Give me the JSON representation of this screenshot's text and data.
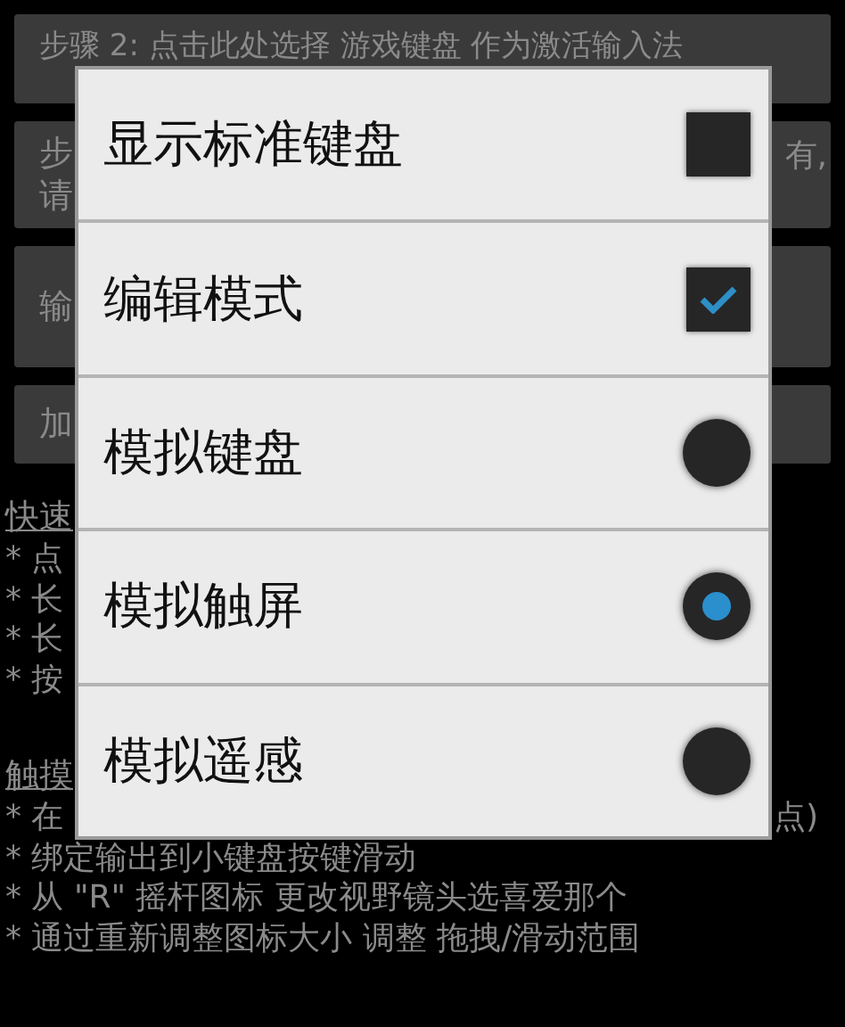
{
  "steps": [
    {
      "lines": [
        "步骤 2: 点击此处选择 游戏键盘 作为激活输入法"
      ]
    },
    {
      "lines": [
        "步",
        "请"
      ],
      "right": "有,"
    },
    {
      "lines": [
        "输"
      ]
    },
    {
      "lines": [
        "加"
      ]
    }
  ],
  "sections": [
    {
      "heading": "快速",
      "items": [
        {
          "text": "* 点"
        },
        {
          "text": "* 长"
        },
        {
          "text": "* 长"
        },
        {
          "text": "* 按"
        }
      ]
    },
    {
      "heading": "触摸",
      "items": [
        {
          "text": "* 在",
          "right": "点)"
        },
        {
          "text": "* 绑定输出到小键盘按键滑动"
        },
        {
          "text": "* 从 \"R\" 摇杆图标 更改视野镜头选喜爱那个"
        },
        {
          "text": "* 通过重新调整图标大小 调整 拖拽/滑动范围"
        }
      ]
    }
  ],
  "dialog": {
    "options": [
      {
        "label": "显示标准键盘",
        "kind": "checkbox",
        "checked": false
      },
      {
        "label": "编辑模式",
        "kind": "checkbox",
        "checked": true
      },
      {
        "label": "模拟键盘",
        "kind": "radio",
        "selected": false
      },
      {
        "label": "模拟触屏",
        "kind": "radio",
        "selected": true
      },
      {
        "label": "模拟遥感",
        "kind": "radio",
        "selected": false
      }
    ]
  }
}
